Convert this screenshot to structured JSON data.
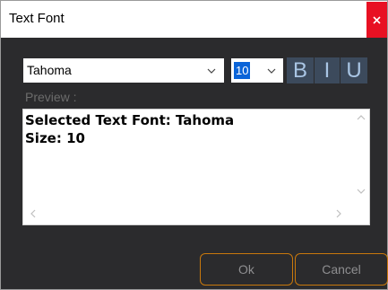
{
  "window": {
    "title": "Text Font",
    "close_icon": "close-icon"
  },
  "font": {
    "selected": "Tahoma"
  },
  "size": {
    "selected": "10"
  },
  "style_buttons": {
    "bold": "B",
    "italic": "I",
    "underline": "U"
  },
  "preview": {
    "label": "Preview :",
    "line1": "Selected Text Font: Tahoma",
    "line2": "Size: 10"
  },
  "actions": {
    "ok": "Ok",
    "cancel": "Cancel"
  },
  "colors": {
    "background": "#2b2b2d",
    "accent_border": "#c8780c",
    "close_red": "#e81123",
    "selection_blue": "#0a64d8",
    "style_button_bg": "#3c4a5c"
  }
}
